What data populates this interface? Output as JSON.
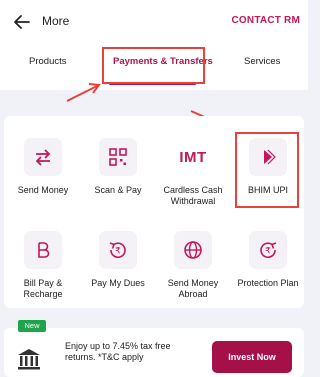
{
  "header": {
    "title": "More",
    "contact_label": "CONTACT RM"
  },
  "tabs": [
    {
      "label": "Products"
    },
    {
      "label": "Payments & Transfers"
    },
    {
      "label": "Services"
    }
  ],
  "colors": {
    "brand": "#b0144f",
    "highlight": "#e8413a",
    "badge": "#1ea54c",
    "button": "#a51048"
  },
  "grid": {
    "items": [
      {
        "label": "Send Money",
        "icon": "swap-arrows-icon"
      },
      {
        "label": "Scan & Pay",
        "icon": "qr-code-icon"
      },
      {
        "label": "Cardless Cash Withdrawal",
        "icon": "imt-icon",
        "icon_text": "IMT"
      },
      {
        "label": "BHIM UPI",
        "icon": "bhim-upi-icon"
      },
      {
        "label": "Bill Pay & Recharge",
        "icon": "bill-pay-icon"
      },
      {
        "label": "Pay My Dues",
        "icon": "rupee-refresh-icon"
      },
      {
        "label": "Send Money Abroad",
        "icon": "globe-icon"
      },
      {
        "label": "Protection Plan",
        "icon": "rupee-shield-icon"
      }
    ]
  },
  "promo": {
    "badge": "New",
    "text": "Enjoy up to 7.45% tax free returns. *T&C apply",
    "button": "Invest Now",
    "icon": "bank-icon"
  }
}
